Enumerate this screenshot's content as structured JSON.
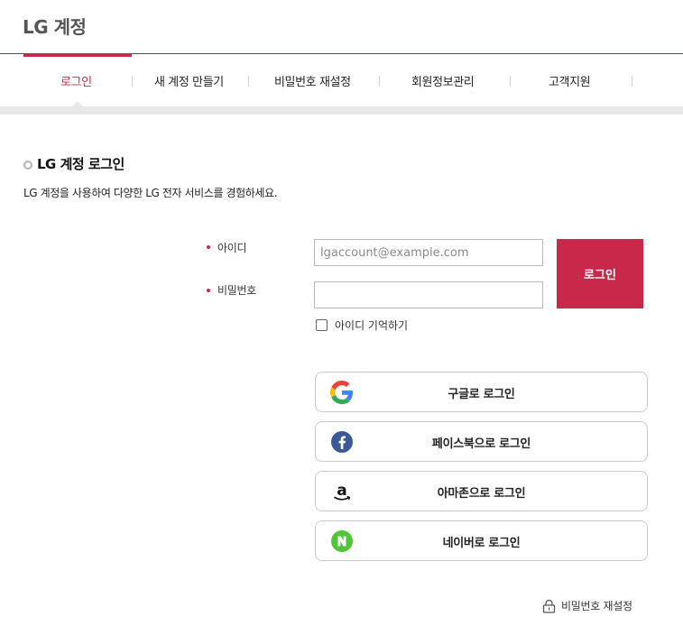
{
  "header": {
    "title": "LG 계정"
  },
  "nav": {
    "tabs": [
      {
        "label": "로그인"
      },
      {
        "label": "새 계정 만들기"
      },
      {
        "label": "비밀번호 재설정"
      },
      {
        "label": "회원정보관리"
      },
      {
        "label": "고객지원"
      }
    ]
  },
  "section": {
    "title": "LG 계정 로그인",
    "description": "LG 계정을 사용하여 다양한 LG 전자 서비스를 경험하세요."
  },
  "form": {
    "id_label": "아이디",
    "id_placeholder": "lgaccount@example.com",
    "password_label": "비밀번호",
    "login_button": "로그인",
    "remember_label": "아이디 기억하기"
  },
  "social": {
    "google": "구글로 로그인",
    "facebook": "페이스북으로 로그인",
    "amazon": "아마존으로 로그인",
    "naver": "네이버로 로그인"
  },
  "footer": {
    "password_reset": "비밀번호 재설정"
  },
  "colors": {
    "accent": "#c8294a",
    "facebook": "#3b5998",
    "naver": "#52c43a"
  },
  "icons": [
    "google-icon",
    "facebook-icon",
    "amazon-icon",
    "naver-icon",
    "lock-icon"
  ]
}
